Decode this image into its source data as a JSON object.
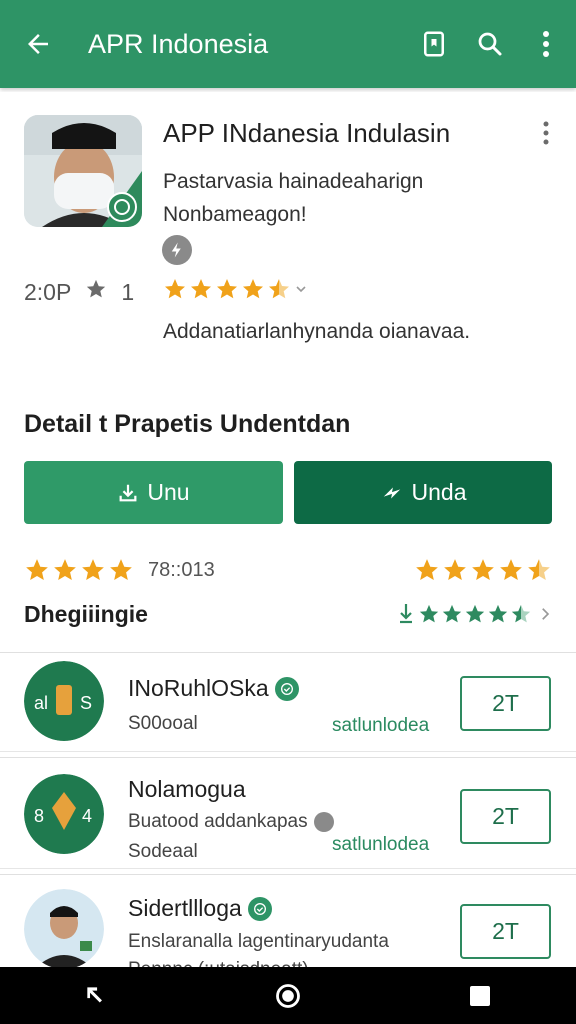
{
  "appbar": {
    "title": "APR Indonesia",
    "back_icon": "arrow-left-icon",
    "actions": [
      "bookmark-icon",
      "search-icon",
      "more-vert-icon"
    ],
    "color": "#2e9466"
  },
  "app": {
    "name": "APP INdanesia Indulasin",
    "description_line1": "Pastarvasia hainadeaharign",
    "description_line2": "Nonbameagon!",
    "meta_left": "2:0P",
    "meta_count": "1",
    "rating_stars": 4.5,
    "tagline": "Addanatiarlanhynanda oianavaa."
  },
  "details": {
    "section_title": "Detail t Prapetis Undentdan",
    "install_button": "Unu",
    "update_button": "Unda",
    "install_color": "#2f9a68",
    "update_color": "#0d6a45",
    "rating_value": "78::013",
    "left_stars": 4,
    "right_stars": 4.5,
    "review_label": "Dhegiiingie"
  },
  "list": [
    {
      "title": "INoRuhlOSka",
      "avatar_text": "al  S",
      "sub": "S00ooal",
      "link": "satlunlodea",
      "button": "2T"
    },
    {
      "title": "Nolamogua",
      "avatar_text": "8  4",
      "sub": "Buatood addankapas",
      "sub2": "Sodeaal",
      "link": "satlunlodea",
      "button": "2T"
    },
    {
      "title": "Sidertllloga",
      "sub": "Enslaranalla lagentinaryudanta",
      "sub2": "Pennnc (:utaisdneatt)",
      "button": "2T"
    }
  ],
  "navbar": {
    "items": [
      "back-nav-icon",
      "home-nav-icon",
      "recents-nav-icon"
    ]
  }
}
